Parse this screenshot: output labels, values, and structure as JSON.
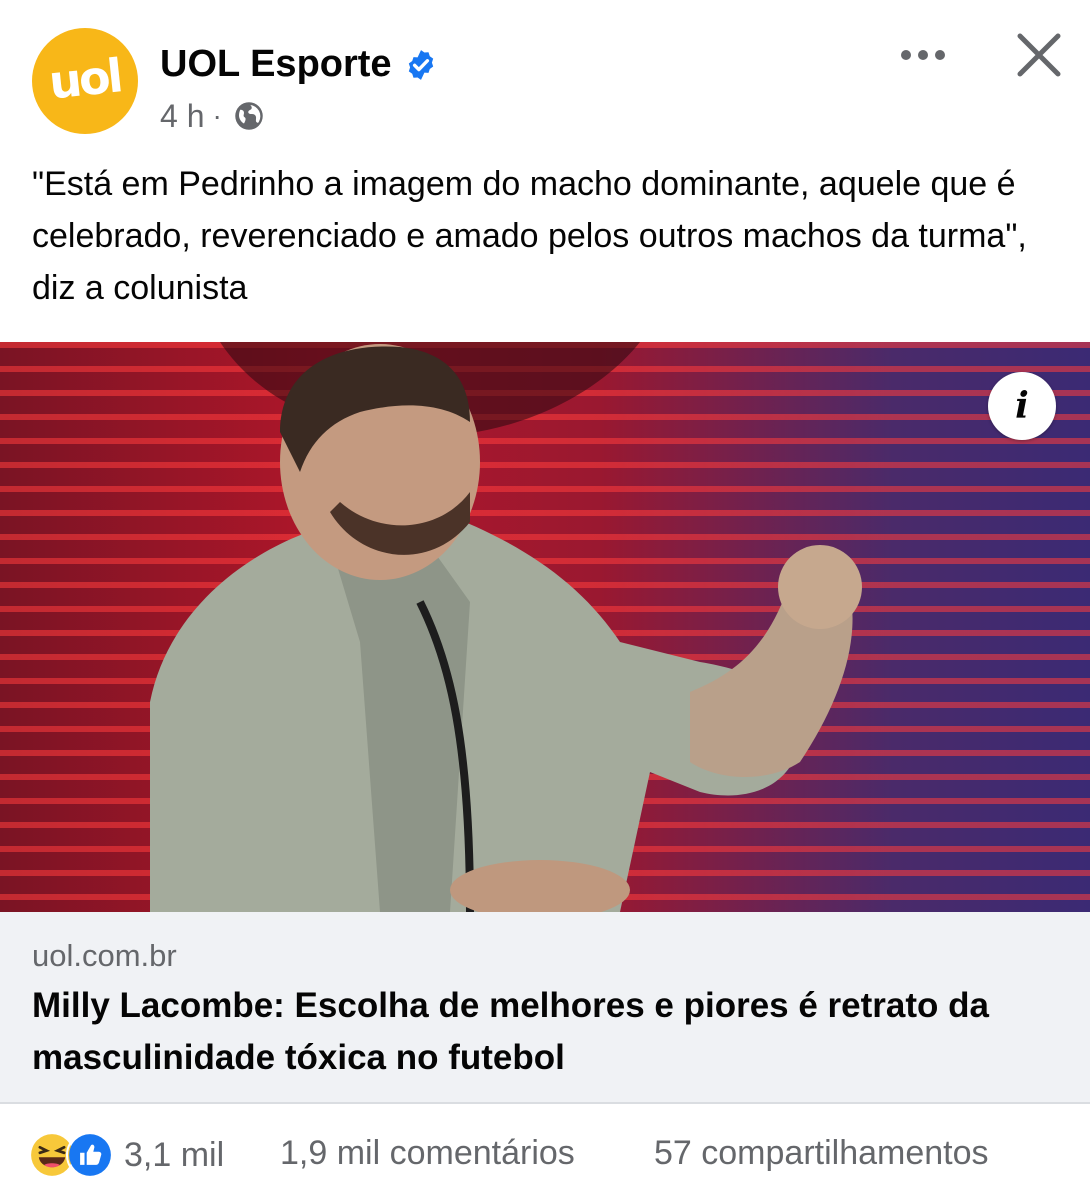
{
  "post": {
    "page_name": "UOL Esporte",
    "avatar_text": "uol",
    "time": "4 h",
    "separator": "·",
    "caption": "\"Está em Pedrinho a imagem do macho dominante, aquele que é celebrado, reverenciado e amado pelos outros machos da turma\", diz a colunista",
    "info_glyph": "i"
  },
  "link": {
    "domain": "uol.com.br",
    "headline": "Milly Lacombe: Escolha de melhores e piores é retrato da masculinidade tóxica no futebol"
  },
  "footer": {
    "reactions_count": "3,1 mil",
    "comments": "1,9 mil comentários",
    "shares": "57 compartilhamentos"
  },
  "icons": {
    "verified": "verified-badge-icon",
    "globe": "globe-icon",
    "more": "more-options-icon",
    "close": "close-icon",
    "info": "info-icon",
    "haha": "haha-reaction-icon",
    "like": "like-reaction-icon"
  },
  "colors": {
    "brand_uol": "#f8b718",
    "facebook_blue": "#1877f2",
    "secondary_text": "#65676b",
    "link_box_bg": "#f0f2f5"
  }
}
